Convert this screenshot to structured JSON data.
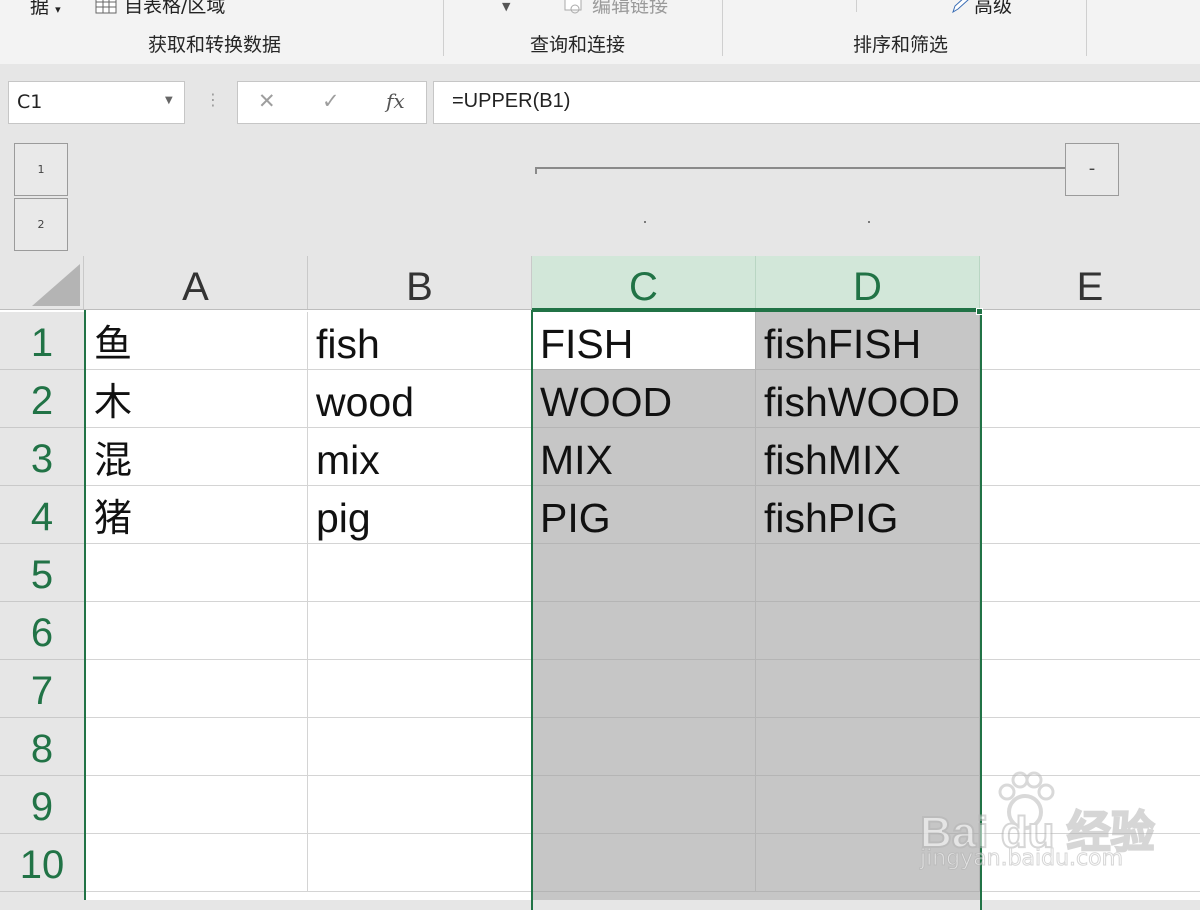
{
  "ribbon": {
    "partial_data_label": "据",
    "from_table_label": "自表格/区域",
    "edit_links_label": "编辑链接",
    "advanced_label": "高级",
    "groups": {
      "get_transform": "获取和转换数据",
      "queries_connections": "查询和连接",
      "sort_filter": "排序和筛选"
    }
  },
  "formula_bar": {
    "name_box": "C1",
    "cancel_glyph": "✕",
    "enter_glyph": "✓",
    "fx_glyph": "fx",
    "formula": "=UPPER(B1)"
  },
  "outline": {
    "levels": [
      "1",
      "2"
    ],
    "collapse_glyph": "-"
  },
  "columns": [
    "A",
    "B",
    "C",
    "D",
    "E"
  ],
  "rows": [
    "1",
    "2",
    "3",
    "4",
    "5",
    "6",
    "7",
    "8",
    "9",
    "10"
  ],
  "cells": {
    "A": [
      "鱼",
      "木",
      "混",
      "猪"
    ],
    "B": [
      "fish",
      "wood",
      "mix",
      "pig"
    ],
    "C": [
      "FISH",
      "WOOD",
      "MIX",
      "PIG"
    ],
    "D": [
      "fishFISH",
      "fishWOOD",
      "fishMIX",
      "fishPIG"
    ]
  },
  "selection": {
    "active_cell": "C1",
    "range": "C1:D10",
    "selected_columns": [
      "C",
      "D"
    ],
    "accent_color": "#217346",
    "selected_fill": "#c6c6c6"
  },
  "watermark": {
    "logo_text": "Bai du 经验",
    "url_text": "jingyan.baidu.com"
  }
}
